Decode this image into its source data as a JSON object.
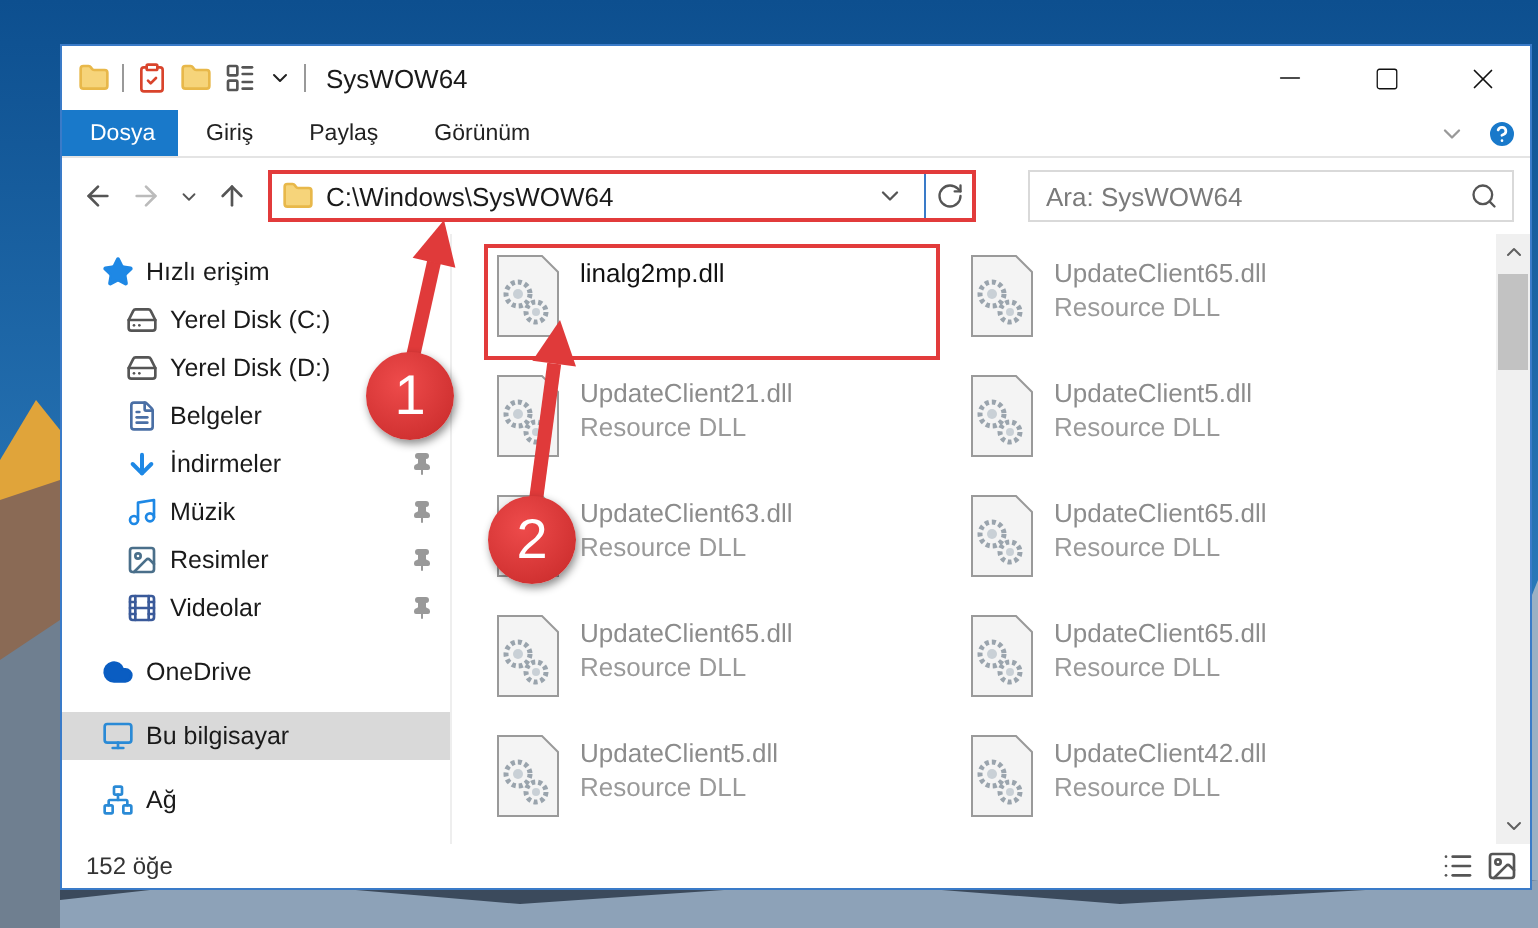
{
  "window": {
    "title": "SysWOW64"
  },
  "ribbon_tabs": [
    {
      "label": "Dosya",
      "selected": true
    },
    {
      "label": "Giriş",
      "selected": false
    },
    {
      "label": "Paylaş",
      "selected": false
    },
    {
      "label": "Görünüm",
      "selected": false
    }
  ],
  "address_bar": {
    "path": "C:\\Windows\\SysWOW64",
    "highlighted": true
  },
  "search": {
    "placeholder": "Ara: SysWOW64"
  },
  "sidebar": {
    "items": [
      {
        "kind": "quick-access",
        "label": "Hızlı erişim",
        "pinned": false,
        "selected": false
      },
      {
        "kind": "system-drive",
        "label": "Yerel Disk (C:)",
        "pinned": false,
        "selected": false
      },
      {
        "kind": "drive",
        "label": "Yerel Disk (D:)",
        "pinned": false,
        "selected": false
      },
      {
        "kind": "documents",
        "label": "Belgeler",
        "pinned": false,
        "selected": false
      },
      {
        "kind": "downloads",
        "label": "İndirmeler",
        "pinned": true,
        "selected": false
      },
      {
        "kind": "music",
        "label": "Müzik",
        "pinned": true,
        "selected": false
      },
      {
        "kind": "pictures",
        "label": "Resimler",
        "pinned": true,
        "selected": false
      },
      {
        "kind": "videos",
        "label": "Videolar",
        "pinned": true,
        "selected": false
      },
      {
        "kind": "onedrive",
        "label": "OneDrive",
        "pinned": false,
        "selected": false
      },
      {
        "kind": "computer",
        "label": "Bu bilgisayar",
        "pinned": false,
        "selected": true
      },
      {
        "kind": "network",
        "label": "Ağ",
        "pinned": false,
        "selected": false
      }
    ]
  },
  "files": [
    {
      "name": "linalg2mp.dll",
      "highlighted": true,
      "blurred": false
    },
    {
      "name": "UpdateClient65.dll",
      "type": "Resource DLL",
      "highlighted": false,
      "blurred": true
    },
    {
      "name": "UpdateClient21.dll",
      "type": "Resource DLL",
      "highlighted": false,
      "blurred": true
    },
    {
      "name": "UpdateClient5.dll",
      "type": "Resource DLL",
      "highlighted": false,
      "blurred": true
    },
    {
      "name": "UpdateClient63.dll",
      "type": "Resource DLL",
      "highlighted": false,
      "blurred": true
    },
    {
      "name": "UpdateClient65.dll",
      "type": "Resource DLL",
      "highlighted": false,
      "blurred": true
    },
    {
      "name": "UpdateClient65.dll",
      "type": "Resource DLL",
      "highlighted": false,
      "blurred": true
    },
    {
      "name": "UpdateClient65.dll",
      "type": "Resource DLL",
      "highlighted": false,
      "blurred": true
    },
    {
      "name": "UpdateClient5.dll",
      "type": "Resource DLL",
      "highlighted": false,
      "blurred": true
    },
    {
      "name": "UpdateClient42.dll",
      "type": "Resource DLL",
      "highlighted": false,
      "blurred": true
    }
  ],
  "status_bar": {
    "count": "152 öğe"
  },
  "callouts": [
    {
      "number": "1"
    },
    {
      "number": "2"
    }
  ]
}
